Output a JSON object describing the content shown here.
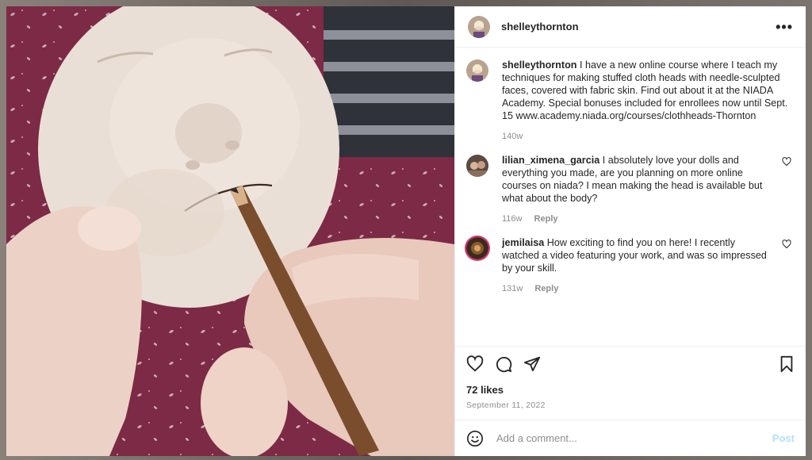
{
  "post": {
    "username": "shelleythornton",
    "more_label": "•••"
  },
  "caption": {
    "username": "shelleythornton",
    "text": "I have a new online course where I teach my techniques for making stuffed cloth heads with needle-sculpted faces, covered with fabric skin. Find out about it at the NIADA Academy. Special bonuses included for enrollees now until Sept. 15 www.academy.niada.org/courses/clothheads-Thornton",
    "age": "140w"
  },
  "comments": [
    {
      "username": "lilian_ximena_garcia",
      "text": "I absolutely love your dolls and everything you made, are you planning on more online courses on niada? I mean making the head is available but what about the body?",
      "age": "116w",
      "reply_label": "Reply"
    },
    {
      "username": "jemilaisa",
      "text": "How exciting to find you on here! I recently watched a video featuring your work, and was so impressed by your skill.",
      "age": "131w",
      "reply_label": "Reply"
    }
  ],
  "actions": {
    "icons": [
      "heart-icon",
      "comment-icon",
      "share-icon",
      "bookmark-icon"
    ]
  },
  "likes": "72 likes",
  "date": "September 11, 2022",
  "add_comment": {
    "placeholder": "Add a comment...",
    "post_label": "Post"
  },
  "colors": {
    "post_button": "#b2dffc",
    "meta_text": "#8e8e8e",
    "photo_fabric": "#7c2a45"
  }
}
